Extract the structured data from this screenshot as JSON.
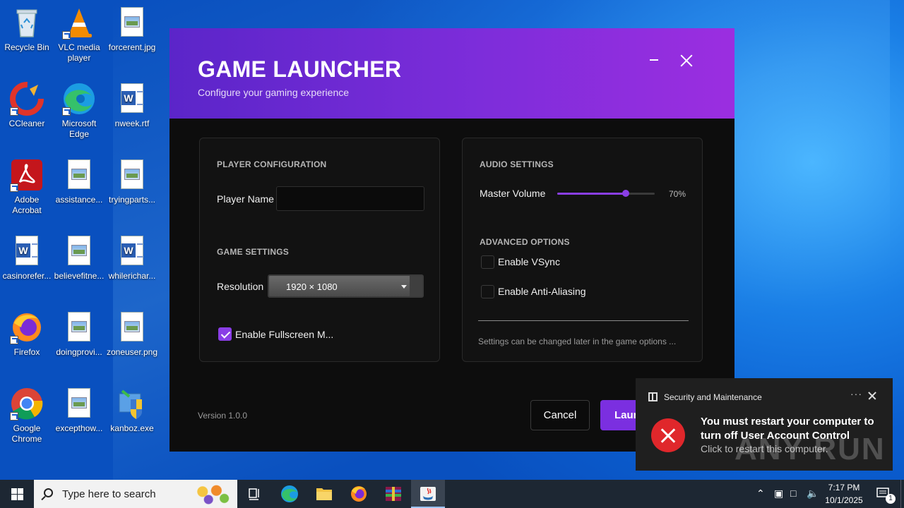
{
  "desktop": {
    "icons": [
      {
        "label": "Recycle Bin",
        "icon": "recycle-bin-icon"
      },
      {
        "label": "VLC media player",
        "icon": "vlc-icon"
      },
      {
        "label": "forcerent.jpg",
        "icon": "image-file-icon"
      },
      {
        "label": "CCleaner",
        "icon": "ccleaner-icon"
      },
      {
        "label": "Microsoft Edge",
        "icon": "edge-icon"
      },
      {
        "label": "nweek.rtf",
        "icon": "word-file-icon"
      },
      {
        "label": "Adobe Acrobat",
        "icon": "acrobat-icon"
      },
      {
        "label": "assistance...",
        "icon": "image-file-icon"
      },
      {
        "label": "tryingparts...",
        "icon": "image-file-icon"
      },
      {
        "label": "casinorefer...",
        "icon": "word-file-icon"
      },
      {
        "label": "believefitne...",
        "icon": "image-file-icon"
      },
      {
        "label": "whilerichar...",
        "icon": "word-file-icon"
      },
      {
        "label": "Firefox",
        "icon": "firefox-icon"
      },
      {
        "label": "doingprovi...",
        "icon": "image-file-icon"
      },
      {
        "label": "zoneuser.png",
        "icon": "image-file-icon"
      },
      {
        "label": "Google Chrome",
        "icon": "chrome-icon"
      },
      {
        "label": "excepthow...",
        "icon": "image-file-icon"
      },
      {
        "label": "kanboz.exe",
        "icon": "installer-icon"
      }
    ]
  },
  "launcher": {
    "title": "GAME LAUNCHER",
    "subtitle": "Configure your gaming experience",
    "player_section": "PLAYER CONFIGURATION",
    "player_name_label": "Player Name",
    "player_name_value": "",
    "game_section": "GAME SETTINGS",
    "resolution_label": "Resolution",
    "resolution_value": "1920 × 1080",
    "fullscreen_label": "Enable Fullscreen M...",
    "fullscreen_checked": true,
    "audio_section": "AUDIO SETTINGS",
    "volume_label": "Master Volume",
    "volume_value": "70%",
    "volume_fraction": 0.7,
    "advanced_section": "ADVANCED OPTIONS",
    "vsync_label": "Enable VSync",
    "vsync_checked": false,
    "aa_label": "Enable Anti-Aliasing",
    "aa_checked": false,
    "note": "Settings can be changed later in the game options ...",
    "version": "Version 1.0.0",
    "cancel_label": "Cancel",
    "launch_label": "Laun",
    "accent": "#8a3ee6"
  },
  "toast": {
    "app": "Security and Maintenance",
    "more": "···",
    "heading": "You must restart your computer to turn off User Account Control",
    "body": "Click to restart this computer.",
    "watermark": "ANY RUN"
  },
  "taskbar": {
    "search_placeholder": "Type here to search",
    "time": "7:17 PM",
    "date": "10/1/2025",
    "notification_count": "1"
  }
}
